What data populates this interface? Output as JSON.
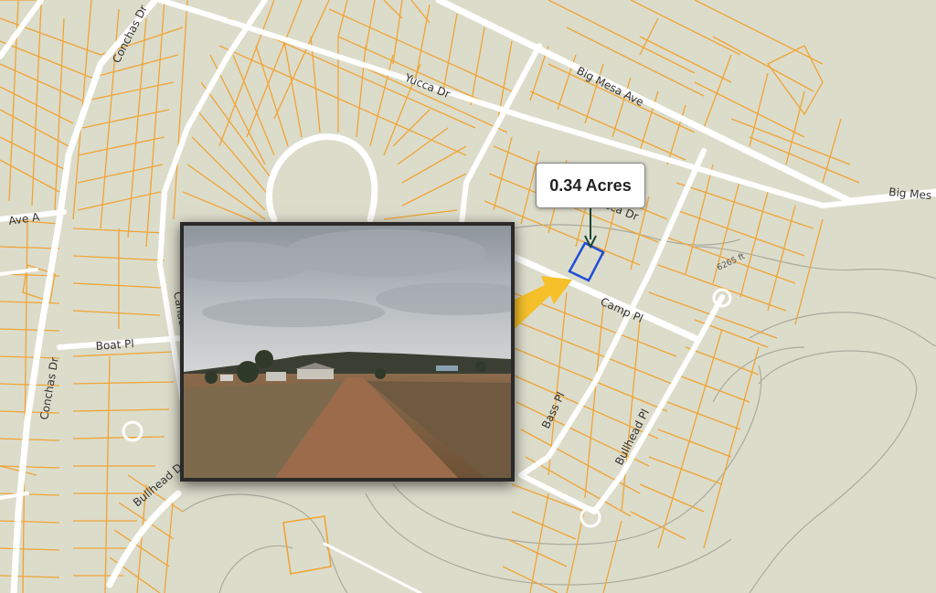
{
  "map": {
    "parcel_callout": "0.34 Acres",
    "contour_label": "6265 ft",
    "streets": {
      "big_mesa_ave": "Big Mesa Ave",
      "big_mesa_edge": "Big Mes",
      "yucca_dr": "Yucca Dr",
      "yucca_dr_2": "Yucca Dr",
      "conchas_dr_top": "Conchas Dr",
      "conchas_dr_left": "Conchas Dr",
      "ave_a": "Ave A",
      "boat_pl": "Boat Pl",
      "canada": "Canada",
      "camp_pl": "Camp Pl",
      "bass_pl": "Bass Pl",
      "bullhead_pl": "Bullhead Pl",
      "bullhead_dr": "Bullhead Dr"
    },
    "colors": {
      "background": "#dcdccb",
      "parcel_lines": "#f0a434",
      "roads": "#ffffff",
      "highlight_parcel": "#1f4fd6",
      "arrow": "#f5c02a",
      "contour": "#a9ab9e"
    }
  },
  "photo": {
    "subject": "dirt-road-landscape"
  }
}
